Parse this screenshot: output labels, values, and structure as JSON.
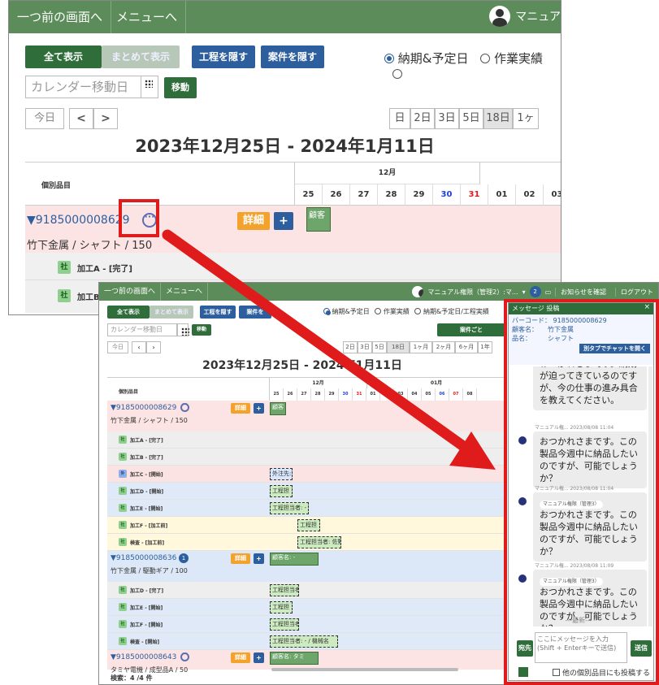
{
  "big": {
    "nav": {
      "back": "一つ前の画面へ",
      "menu": "メニューへ",
      "user": "マニュア"
    },
    "buttons": {
      "show_all": "全て表示",
      "show_grouped": "まとめて表示",
      "hide_process": "工程を隠す",
      "hide_case": "案件を隠す",
      "move": "移動"
    },
    "radios": {
      "r1": "納期&予定日",
      "r2": "作業実績"
    },
    "calendar_placeholder": "カレンダー移動日",
    "today": "今日",
    "prev": "<",
    "next": ">",
    "ranges": [
      "日",
      "2日",
      "3日",
      "5日",
      "18日",
      "1ヶ"
    ],
    "date_range": "2023年12月25日 - 2024年1月11日",
    "col_header": "個別品目",
    "month": "12月",
    "days": [
      "25",
      "26",
      "27",
      "28",
      "29",
      "30",
      "31",
      "01",
      "02",
      "03"
    ],
    "item_code": "▼9185000008629",
    "item_sub": "竹下金属 / シャフト / 150",
    "detail": "詳細",
    "plus": "+",
    "bar_label": "顧客",
    "proc1": "加工A - [完了]",
    "proc2": "加工B - [",
    "badge": "社"
  },
  "small": {
    "nav": {
      "back": "一つ前の画面へ",
      "menu": "メニューへ",
      "user": "マニュアル権限（管理2）:マ...",
      "notif_count": "2",
      "notice": "お知らせを確認",
      "logout": "ログアウト"
    },
    "buttons": {
      "show_all": "全て表示",
      "show_grouped": "まとめて表示",
      "hide_process": "工程を隠す",
      "hide_case": "案件を",
      "move": "移動",
      "by_case": "案件ごと"
    },
    "radios": {
      "r1": "納期&予定日",
      "r2": "作業実績",
      "r3": "納期&予定日/工程実績"
    },
    "calendar_placeholder": "カレンダー移動日",
    "today": "今日",
    "ranges": [
      "2日",
      "3日",
      "5日",
      "18日",
      "1ヶ月",
      "2ヶ月",
      "6ヶ月",
      "1年"
    ],
    "date_range": "2023年12月25日 - 2024年1月11日",
    "col_header": "個別品目",
    "months": [
      "12月",
      "01月"
    ],
    "days": [
      "25",
      "26",
      "27",
      "28",
      "29",
      "30",
      "31",
      "01",
      "02",
      "03",
      "04",
      "05",
      "06",
      "07",
      "08"
    ],
    "groups": [
      {
        "code": "▼9185000008629",
        "sub": "竹下金属 / シャフト / 150"
      },
      {
        "code": "▼9185000008636",
        "sub": "竹下金属 / 駆動ギア / 100",
        "count": "1"
      },
      {
        "code": "▼9185000008643",
        "sub": "タミヤ電機 / 成型品A / 50"
      }
    ],
    "rows1": [
      {
        "badge": "社",
        "label": "加工A - [完了]"
      },
      {
        "badge": "社",
        "label": "加工B - [完了]"
      },
      {
        "badge": "外",
        "label": "加工C - [開始]",
        "bar": "外注先:"
      },
      {
        "badge": "社",
        "label": "加工D - [開始]",
        "bar": "工程担"
      },
      {
        "badge": "社",
        "label": "加工E - [開始]",
        "bar": "工程担当者: -"
      },
      {
        "badge": "社",
        "label": "加工F - [加工前]",
        "bar": "工程担"
      },
      {
        "badge": "社",
        "label": "検査 - [加工前]",
        "bar": "工程担当者: 佐野"
      }
    ],
    "rows2": [
      {
        "badge": "社",
        "label": "加工D - [完了]",
        "bar": "工程担当者:"
      },
      {
        "badge": "社",
        "label": "加工E - [開始]",
        "bar": "工程担"
      },
      {
        "badge": "社",
        "label": "加工F - [開始]",
        "bar": "工程担当者:"
      },
      {
        "badge": "社",
        "label": "検査 - [開始]",
        "bar": "工程担当者: - / 機械名"
      }
    ],
    "bar_g1": "顧客",
    "bar_g2": "顧客名: -",
    "bar_g3": "顧客名: タミ",
    "detail": "詳細",
    "footer": "検索：4 /4 件"
  },
  "chat": {
    "title": "メッセージ 投稿",
    "barcode_label": "バーコード：",
    "barcode": "9185000008629",
    "customer_label": "顧客名：",
    "customer": "竹下金属",
    "product_label": "品名：",
    "product": "シャフト",
    "open_tab": "別タブでチャットを開く",
    "messages": [
      {
        "text": "おつかれさまです。納期が迫ってきているのですが、今の仕事の進み具合を教えてください。"
      },
      {
        "author": "マニュアル権... 2023/08/08 11:04",
        "text": "おつかれさまです。この製品今週中に納品したいのですが、可能でしょうか？"
      },
      {
        "author": "マニュアル権... 2023/08/08 11:04",
        "mention": "マニュアル権限（管理3）",
        "text": "おつかれさまです。この製品今週中に納品したいのですが、可能でしょうか？"
      },
      {
        "author": "マニュアル権... 2023/08/08 11:09",
        "mention": "マニュアル権限（管理3）",
        "text": "おつかれさまです。この製品今週中に納品したいのですが、可能でしょうか？"
      }
    ],
    "latest": "---最新---",
    "to_btn": "宛先",
    "input_placeholder": "ここにメッセージを入力\n(Shift + Enterキーで送信)",
    "send": "送信",
    "crosspost": "他の個別品目にも投稿する"
  }
}
